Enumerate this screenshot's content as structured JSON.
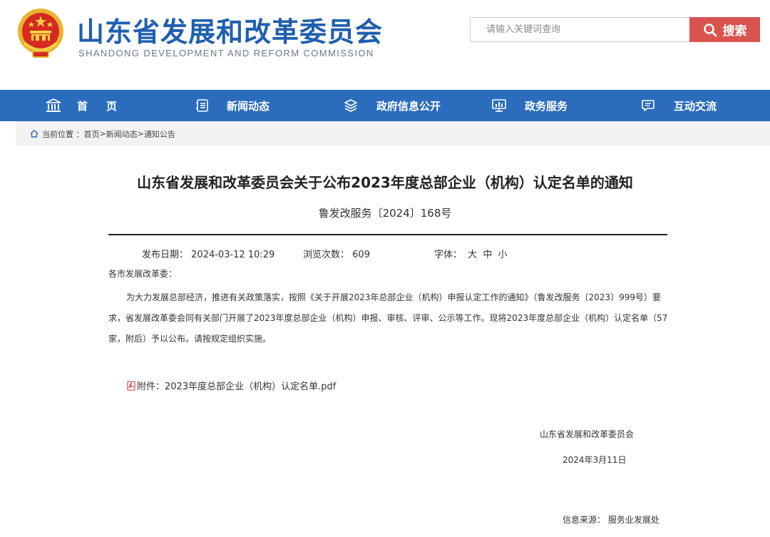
{
  "header": {
    "title": "山东省发展和改革委员会",
    "subtitle": "SHANDONG DEVELOPMENT AND REFORM COMMISSION",
    "emblem_icon": "national-emblem-icon"
  },
  "search": {
    "placeholder": "请输入关键词查询",
    "button_label": "搜索",
    "button_color": "#d9534f"
  },
  "nav": {
    "color": "#2b6cbd",
    "items": [
      {
        "label": "首页",
        "icon": "government-building-icon"
      },
      {
        "label": "新闻动态",
        "icon": "document-list-icon"
      },
      {
        "label": "政府信息公开",
        "icon": "layers-icon"
      },
      {
        "label": "政务服务",
        "icon": "monitor-chart-icon"
      },
      {
        "label": "互动交流",
        "icon": "chat-bubble-icon"
      }
    ]
  },
  "breadcrumb": {
    "prefix": "当前位置 ：",
    "items": [
      "首页",
      "新闻动态",
      "通知公告"
    ],
    "separator": ">"
  },
  "article": {
    "title": "山东省发展和改革委员会关于公布2023年度总部企业（机构）认定名单的通知",
    "doc_number": "鲁发改服务〔2024〕168号",
    "publish_label": "发布日期：",
    "publish_date": "2024-03-12 10:29",
    "views_label": "浏览次数：",
    "views": "609",
    "font_label": "字体：",
    "font_options": [
      "大",
      "中",
      "小"
    ],
    "salutation": "各市发展改革委：",
    "body": "为大力发展总部经济，推进有关政策落实，按照《关于开展2023年总部企业（机构）申报认定工作的通知》（鲁发改服务〔2023〕999号）要求，省发展改革委会同有关部门开展了2023年度总部企业（机构）申报、审核、评审、公示等工作。现将2023年度总部企业（机构）认定名单（57家，附后）予以公布。请按规定组织实施。",
    "attachment": "附件：2023年度总部企业（机构）认定名单.pdf",
    "attachment_icon": "pdf-file-icon",
    "signature_org": "山东省发展和改革委员会",
    "signature_date": "2024年3月11日",
    "source_label": "信息来源：",
    "source": "服务业发展处"
  }
}
